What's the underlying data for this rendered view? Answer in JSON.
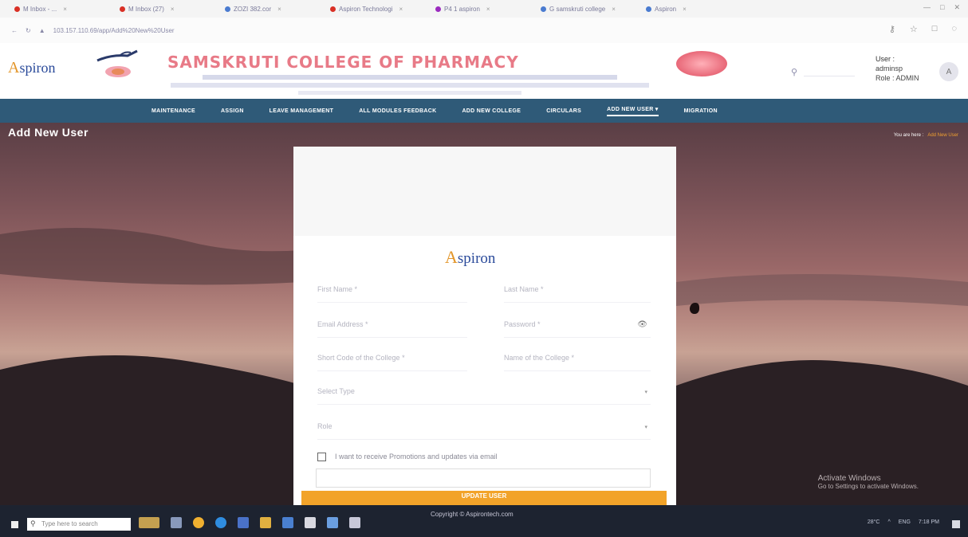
{
  "browser": {
    "tabs": [
      {
        "label": "M Inbox - ...",
        "color": "#d93025"
      },
      {
        "label": "M Inbox (27)",
        "color": "#d93025"
      },
      {
        "label": "ZOZI 382.cor",
        "color": "#4a7bd0"
      },
      {
        "label": "Aspiron Technologi",
        "color": "#d93025"
      },
      {
        "label": "P4 1 aspiron",
        "color": "#9b2bbf"
      },
      {
        "label": "G samskruti college",
        "color": "#4a7bd0"
      },
      {
        "label": "Aspiron",
        "color": "#4a7bd0"
      }
    ],
    "url": "103.157.110.69/app/Add%20New%20User",
    "window_controls": [
      "—",
      "□",
      "✕"
    ]
  },
  "header": {
    "logo_text": "spiron",
    "logo_letter": "A",
    "college_name": "SAMSKRUTI COLLEGE OF PHARMACY",
    "user_label": "User :",
    "user_value": "adminsp",
    "role_label": "Role : ADMIN",
    "avatar_letter": "A"
  },
  "nav": {
    "items": [
      {
        "label": "MAINTENANCE",
        "active": false
      },
      {
        "label": "ASSIGN",
        "active": false
      },
      {
        "label": "LEAVE MANAGEMENT",
        "active": false
      },
      {
        "label": "ALL MODULES FEEDBACK",
        "active": false
      },
      {
        "label": "ADD NEW COLLEGE",
        "active": false
      },
      {
        "label": "CIRCULARS",
        "active": false
      },
      {
        "label": "ADD NEW USER ▾",
        "active": true
      },
      {
        "label": "MIGRATION",
        "active": false
      }
    ]
  },
  "page": {
    "title": "Add New User",
    "breadcrumb_home": "You are here :",
    "breadcrumb_current": "Add New User"
  },
  "form": {
    "logo_text": "spiron",
    "logo_letter": "A",
    "first_name_placeholder": "First Name *",
    "last_name_placeholder": "Last Name *",
    "email_placeholder": "Email Address *",
    "password_placeholder": "Password *",
    "college_code_placeholder": "Short Code of the College *",
    "college_name_placeholder": "Name of the College *",
    "select1_placeholder": "Select Type",
    "select2_placeholder": "Role",
    "checkbox_label": "I want to receive Promotions and updates via email",
    "submit_label": "UPDATE USER",
    "copyright": "Copyright © Aspirontech.com"
  },
  "watermark": {
    "line1": "Activate Windows",
    "line2": "Go to Settings to activate Windows."
  },
  "taskbar": {
    "search_placeholder": "Type here to search",
    "tray_items": [
      "28°C",
      "^",
      "ENG",
      "7:18 PM"
    ]
  }
}
